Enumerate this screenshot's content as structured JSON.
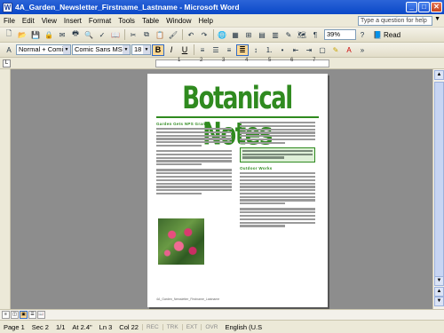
{
  "window": {
    "title": "4A_Garden_Newsletter_Firstname_Lastname - Microsoft Word",
    "app_icon": "W",
    "minimize": "_",
    "maximize": "□",
    "close": "✕"
  },
  "menu": {
    "items": [
      "File",
      "Edit",
      "View",
      "Insert",
      "Format",
      "Tools",
      "Table",
      "Window",
      "Help"
    ],
    "help_placeholder": "Type a question for help"
  },
  "standard_toolbar": {
    "zoom": "39%",
    "read_label": "Read"
  },
  "formatting_toolbar": {
    "style": "Normal + Comic",
    "font": "Comic Sans MS",
    "size": "18",
    "bold": "B",
    "italic": "I",
    "underline": "U"
  },
  "ruler": {
    "numbers": [
      "1",
      "2",
      "3",
      "4",
      "5",
      "6",
      "7"
    ]
  },
  "document": {
    "headline": "Botanical Notes",
    "left_heading": "Garden Gets NPS Grant",
    "right_heading": "Outdoor Works",
    "footer_text": "4A_Garden_Newsletter_Firstname_Lastname"
  },
  "status": {
    "page": "Page 1",
    "sec": "Sec 2",
    "pages": "1/1",
    "at": "At 2.4\"",
    "ln": "Ln 3",
    "col": "Col 22",
    "rec": "REC",
    "trk": "TRK",
    "ext": "EXT",
    "ovr": "OVR",
    "language": "English (U.S"
  },
  "colors": {
    "title_bar": "#0a48c8",
    "headline_green": "#2f8a1f"
  }
}
